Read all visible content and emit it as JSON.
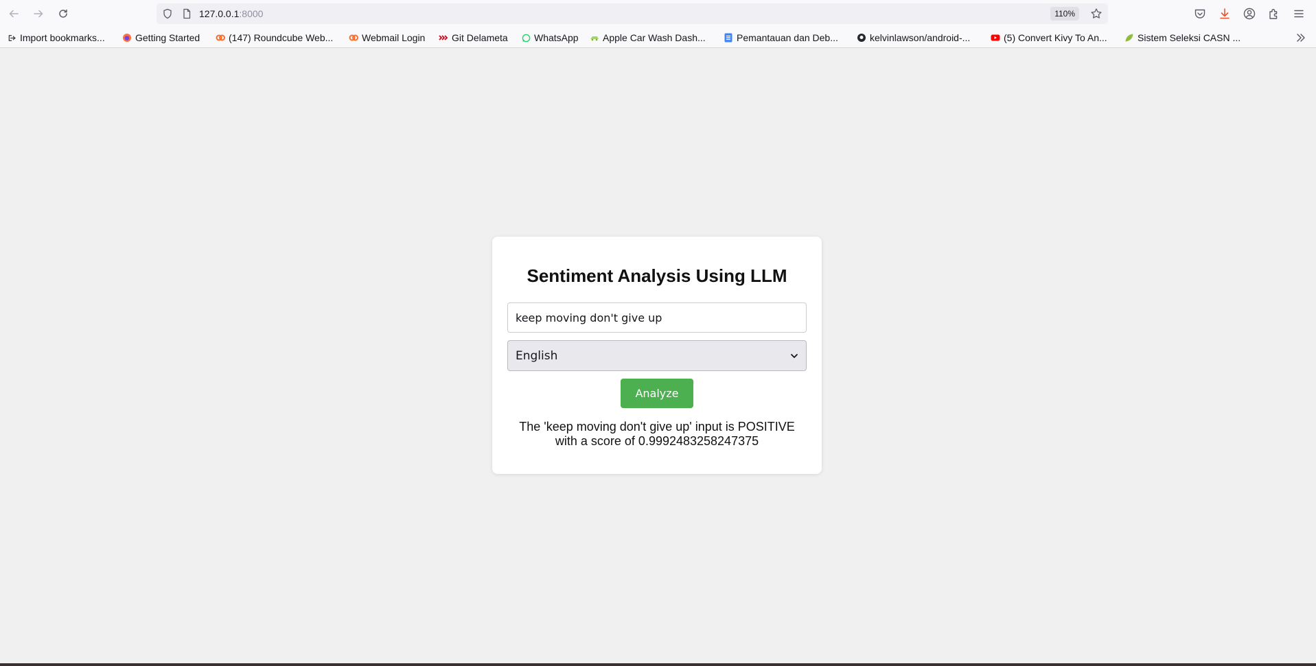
{
  "browser": {
    "url_host": "127.0.0.1",
    "url_port": ":8000",
    "zoom": "110%",
    "bookmarks": [
      {
        "label": "Import bookmarks...",
        "icon": "import-icon"
      },
      {
        "label": "Getting Started",
        "icon": "firefox-icon"
      },
      {
        "label": "(147) Roundcube Web...",
        "icon": "cpanel-icon"
      },
      {
        "label": "Webmail Login",
        "icon": "cpanel-icon"
      },
      {
        "label": "Git Delameta",
        "icon": "git-icon"
      },
      {
        "label": "WhatsApp",
        "icon": "whatsapp-icon"
      },
      {
        "label": "Apple Car Wash Dash...",
        "icon": "car-wash-icon"
      },
      {
        "label": "Pemantauan dan Deb...",
        "icon": "doc-icon"
      },
      {
        "label": "kelvinlawson/android-...",
        "icon": "github-icon"
      },
      {
        "label": "(5) Convert Kivy To An...",
        "icon": "youtube-icon"
      },
      {
        "label": "Sistem Seleksi CASN ...",
        "icon": "leaf-icon"
      }
    ]
  },
  "page": {
    "title": "Sentiment Analysis Using LLM",
    "input_value": "keep moving don't give up",
    "language_selected": "English",
    "analyze_label": "Analyze",
    "result_text": "The 'keep moving don't give up' input is POSITIVE with a score of 0.9992483258247375"
  },
  "colors": {
    "accent_button": "#4caf50",
    "page_background": "#f0f0f0"
  }
}
